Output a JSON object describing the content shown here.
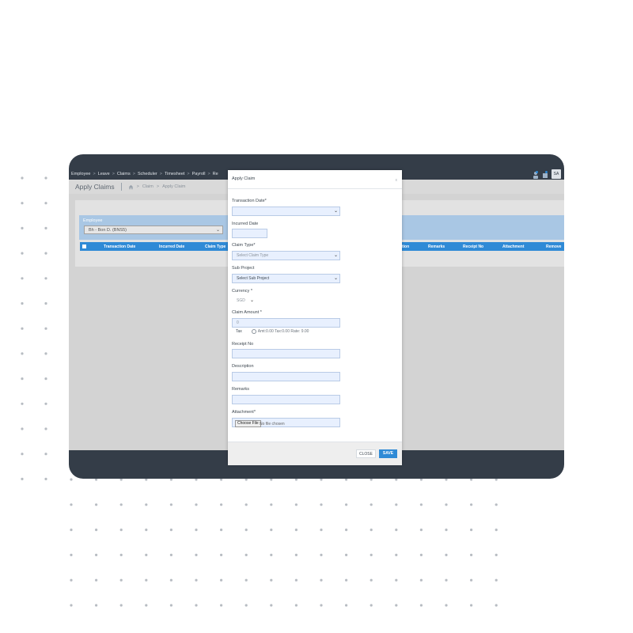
{
  "nav": {
    "items": [
      "Employee",
      "Leave",
      "Claims",
      "Scheduler",
      "Timesheet",
      "Payroll",
      "Re"
    ],
    "separator": ">",
    "avatar_initials": "SA",
    "icons": [
      "user-icon",
      "settings-icon"
    ]
  },
  "page": {
    "title": "Apply Claims",
    "breadcrumb": [
      "Claim",
      "Apply Claim"
    ],
    "breadcrumb_separator": ">"
  },
  "employee": {
    "label": "Employee",
    "selected": "Bh - Bon D.  (BNS5)"
  },
  "table": {
    "columns_left": [
      "Transaction Date",
      "Incurred Date",
      "Claim Type"
    ],
    "columns_right": [
      "tion",
      "Remarks",
      "Receipt No",
      "Attachment",
      "Remove"
    ]
  },
  "modal": {
    "title": "Apply Claim",
    "close_symbol": "x",
    "fields": {
      "transaction_date": {
        "label": "Transaction Date*",
        "value": ""
      },
      "incurred_date": {
        "label": "Incurred Date",
        "value": ""
      },
      "claim_type": {
        "label": "Claim Type*",
        "value": "Select Claim Type"
      },
      "sub_project": {
        "label": "Sub Project",
        "value": "Select Sub Project"
      },
      "currency": {
        "label": "Currency *",
        "value": "SGD"
      },
      "claim_amount": {
        "label": "Claim Amount *",
        "value": "0"
      },
      "tax": {
        "label": "Tax",
        "info": "Amt:0.00 Tax:0.00 Rate: 9.00"
      },
      "receipt_no": {
        "label": "Receipt No",
        "value": ""
      },
      "description": {
        "label": "Description",
        "value": ""
      },
      "remarks": {
        "label": "Remarks",
        "value": ""
      },
      "attachment": {
        "label": "Attachment*",
        "button": "Choose File",
        "status": "No file chosen"
      }
    },
    "buttons": {
      "close": "CLOSE",
      "save": "SAVE"
    }
  },
  "colors": {
    "frame": "#343d48",
    "accent": "#2f8ad6",
    "input_bg": "#e8f0fe",
    "employee_panel": "#a9c7e4"
  }
}
